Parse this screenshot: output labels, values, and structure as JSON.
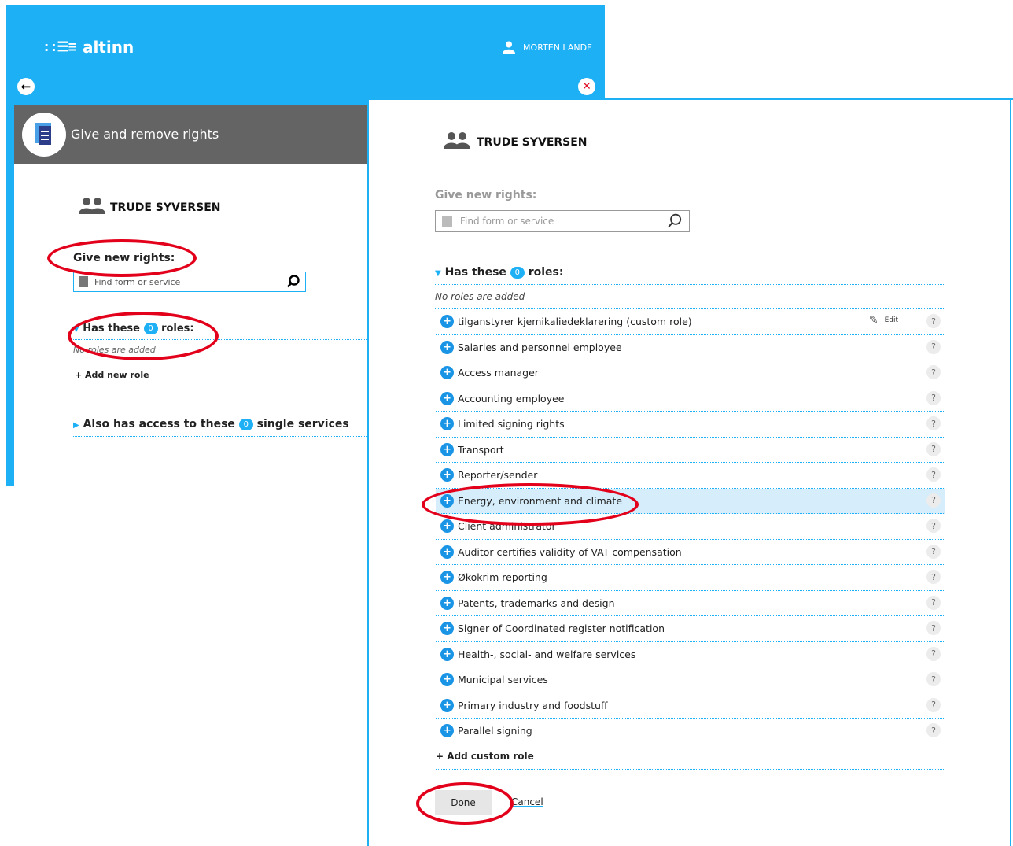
{
  "app": {
    "brand": "altinn",
    "logo": "::☰≡",
    "user": "MORTEN LANDE"
  },
  "left": {
    "card_title": "Give and remove rights",
    "person": "TRUDE SYVERSEN",
    "give_label": "Give new rights:",
    "search_text": "Find form or service",
    "has_roles_pre": "Has these",
    "has_roles_post": "roles:",
    "count": "0",
    "no_roles": "No roles are added",
    "add_new_role": "+ Add new role",
    "also_pre": "Also has access to these",
    "also_post": "single services"
  },
  "right": {
    "person": "TRUDE SYVERSEN",
    "give_label": "Give new rights:",
    "search_placeholder": "Find form or service",
    "has_roles_pre": "Has these",
    "has_roles_post": "roles:",
    "count": "0",
    "no_roles": "No roles are added",
    "edit_label": "Edit",
    "roles": [
      "tilganstyrer kjemikaliedeklarering (custom role)",
      "Salaries and personnel employee",
      "Access manager",
      "Accounting employee",
      "Limited signing rights",
      "Transport",
      "Reporter/sender",
      "Energy, environment and climate",
      "Client administrator",
      "Auditor certifies validity of VAT compensation",
      "Økokrim reporting",
      "Patents, trademarks and design",
      "Signer of Coordinated register notification",
      "Health-, social- and welfare services",
      "Municipal services",
      "Primary industry and foodstuff",
      "Parallel signing"
    ],
    "add_custom_role": "+ Add custom role",
    "done": "Done",
    "cancel": "Cancel"
  },
  "colors": {
    "accent": "#1eb0f5",
    "highlight_ring": "#e3001b",
    "card_header": "#646464"
  }
}
